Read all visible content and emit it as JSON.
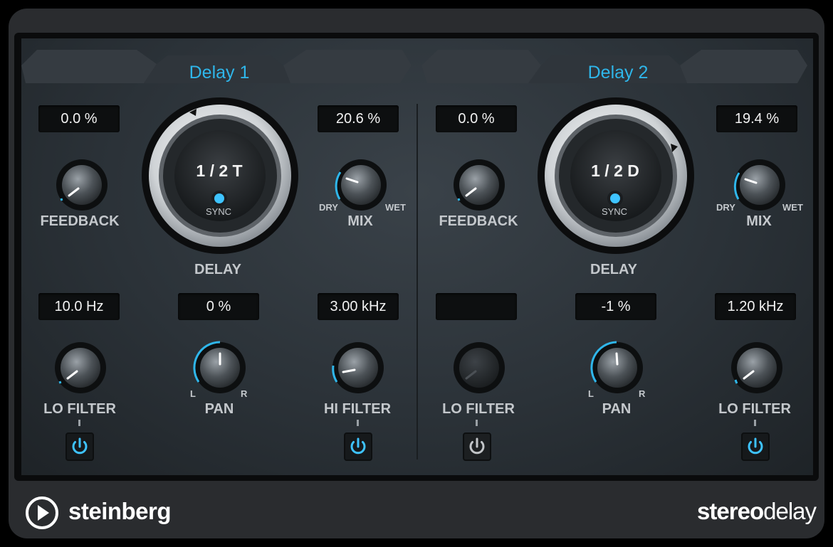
{
  "delay1": {
    "title": "Delay 1",
    "feedback": {
      "value": "0.0 %",
      "label": "FEEDBACK"
    },
    "delay": {
      "value": "1 / 2 T",
      "sync": "SYNC",
      "label": "DELAY"
    },
    "mix": {
      "value": "20.6 %",
      "label": "MIX",
      "dry": "DRY",
      "wet": "WET"
    },
    "lo_filter": {
      "value": "10.0 Hz",
      "label": "LO FILTER",
      "enabled": true
    },
    "pan": {
      "value": "0 %",
      "label": "PAN",
      "left": "L",
      "right": "R"
    },
    "hi_filter": {
      "value": "3.00 kHz",
      "label": "HI FILTER",
      "enabled": true
    }
  },
  "delay2": {
    "title": "Delay 2",
    "feedback": {
      "value": "0.0 %",
      "label": "FEEDBACK"
    },
    "delay": {
      "value": "1 / 2 D",
      "sync": "SYNC",
      "label": "DELAY"
    },
    "mix": {
      "value": "19.4 %",
      "label": "MIX",
      "dry": "DRY",
      "wet": "WET"
    },
    "lo_filter": {
      "value": "",
      "label": "LO FILTER",
      "enabled": false
    },
    "pan": {
      "value": "-1 %",
      "label": "PAN",
      "left": "L",
      "right": "R"
    },
    "hi_filter": {
      "value": "1.20 kHz",
      "label": "LO FILTER",
      "enabled": true
    }
  },
  "footer": {
    "brand": "steinberg",
    "product_bold": "stereo",
    "product_light": "delay"
  },
  "colors": {
    "accent": "#2fb6ea",
    "panel": "#2b3238",
    "display_bg": "#0d0f10"
  },
  "icons": {
    "power": "power-icon",
    "brand_logo": "play-circle-icon"
  }
}
